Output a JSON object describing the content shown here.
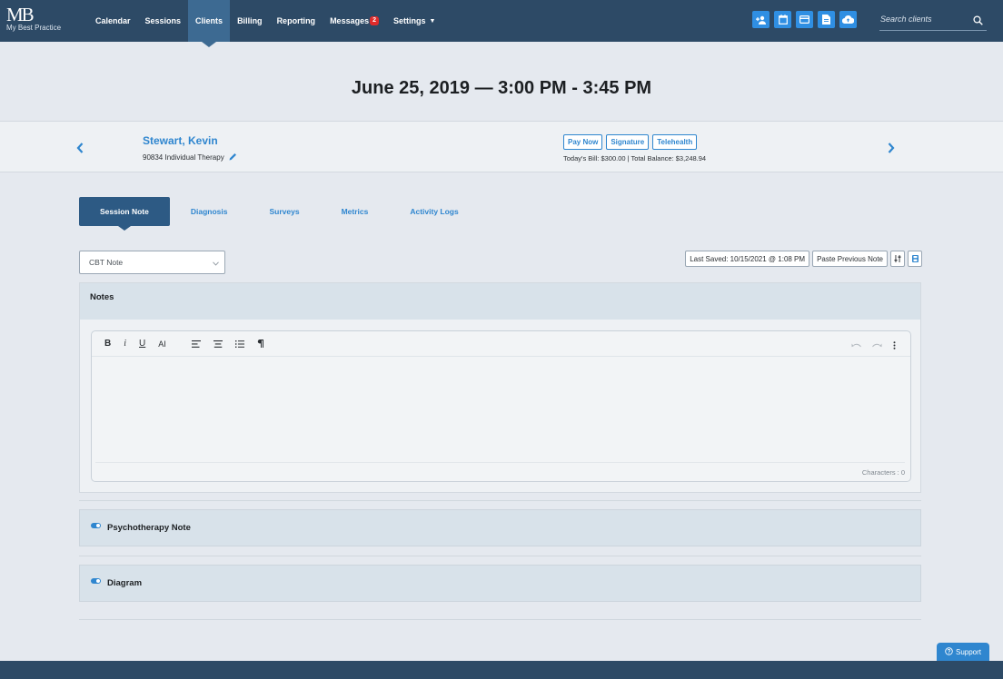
{
  "brand": {
    "logo_mark": "MB",
    "logo_text": "My Best Practice"
  },
  "nav": {
    "items": [
      {
        "label": "Calendar"
      },
      {
        "label": "Sessions"
      },
      {
        "label": "Clients",
        "active": true
      },
      {
        "label": "Billing"
      },
      {
        "label": "Reporting"
      },
      {
        "label": "Messages",
        "badge": "2"
      },
      {
        "label": "Settings"
      }
    ]
  },
  "toolbar_icons": [
    "add-client-icon",
    "calendar-icon",
    "card-icon",
    "document-icon",
    "cloud-upload-icon"
  ],
  "search": {
    "placeholder": "Search clients"
  },
  "session": {
    "date_title": "June 25, 2019 — 3:00 PM - 3:45 PM"
  },
  "client": {
    "name": "Stewart, Kevin",
    "service": "90834 Individual Therapy",
    "buttons": {
      "pay_now": "Pay Now",
      "signature": "Signature",
      "telehealth": "Telehealth"
    },
    "bill_line": "Today's Bill: $300.00 | Total Balance: $3,248.94"
  },
  "tabs": [
    {
      "label": "Session Note",
      "active": true
    },
    {
      "label": "Diagnosis"
    },
    {
      "label": "Surveys"
    },
    {
      "label": "Metrics"
    },
    {
      "label": "Activity Logs"
    }
  ],
  "note_template": {
    "selected": "CBT Note"
  },
  "actions": {
    "last_saved": "Last Saved: 10/15/2021 @ 1:08 PM",
    "paste_previous": "Paste Previous Note"
  },
  "notes": {
    "title": "Notes",
    "toolbar": {
      "bold": "B",
      "italic": "i",
      "underline": "U",
      "font_size": "AI"
    },
    "char_count": "Characters : 0"
  },
  "sections": {
    "psychotherapy": "Psychotherapy Note",
    "diagram": "Diagram"
  },
  "support": {
    "label": "Support"
  },
  "colors": {
    "nav_bg": "#2d4a66",
    "accent": "#2f86cf",
    "badge": "#e02b2b"
  }
}
